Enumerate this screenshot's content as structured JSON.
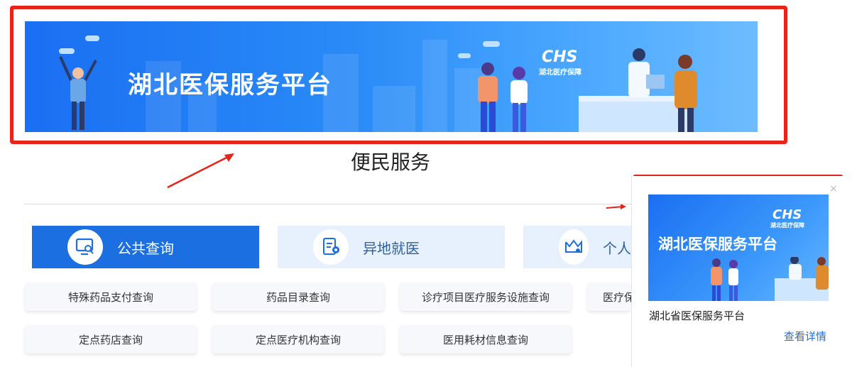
{
  "banner": {
    "title": "湖北医保服务平台",
    "logo": "CHS",
    "logo_sub": "湖北医疗保障"
  },
  "section": {
    "title": "便民服务"
  },
  "tabs": [
    {
      "label": "公共查询",
      "icon": "monitor-search-icon",
      "active": true
    },
    {
      "label": "异地就医",
      "icon": "document-location-icon",
      "active": false
    },
    {
      "label": "个人",
      "icon": "crown-person-icon",
      "active": false
    }
  ],
  "queries_row1": [
    "特殊药品支付查询",
    "药品目录查询",
    "诊疗项目医疗服务设施查询",
    "医疗保"
  ],
  "queries_row2": [
    "定点药店查询",
    "定点医疗机构查询",
    "医用耗材信息查询"
  ],
  "popup": {
    "banner_title": "湖北医保服务平台",
    "logo": "CHS",
    "logo_sub": "湖北医疗保障",
    "caption": "湖北省医保服务平台",
    "link": "查看详情",
    "close": "×"
  },
  "colors": {
    "annotation_red": "#e8231a",
    "tab_active": "#1b6fe0",
    "tab_inactive": "#e7f0fd",
    "link": "#1b6fe0"
  }
}
